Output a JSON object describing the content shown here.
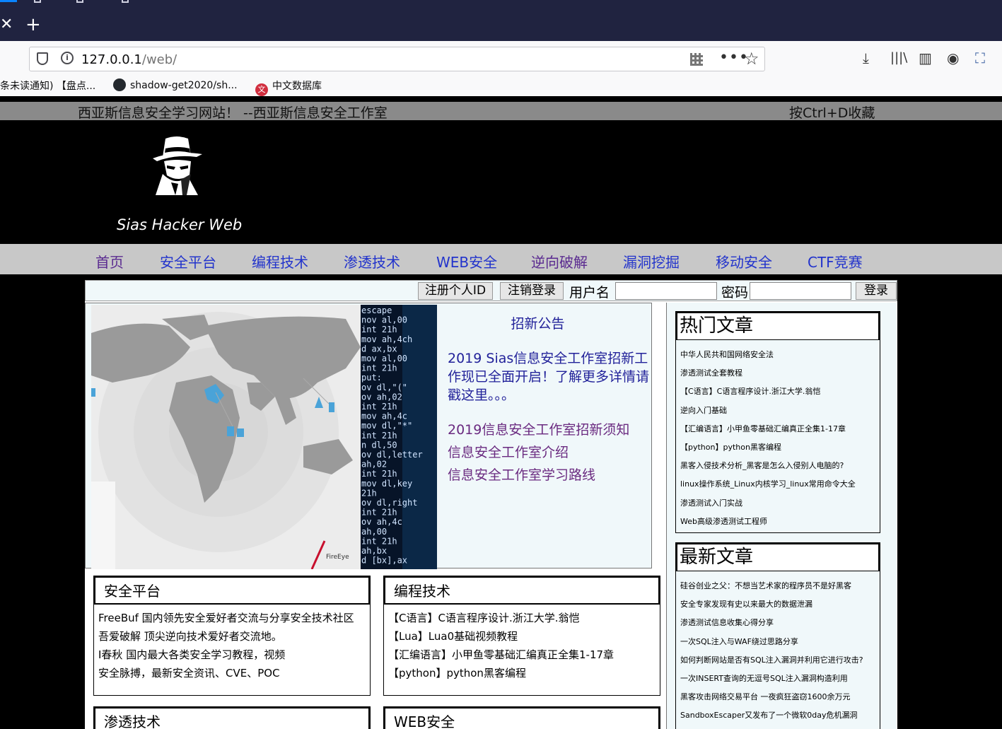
{
  "browser": {
    "url_host": "127.0.0.1",
    "url_path": "/web/",
    "tab_close_glyph": "✕",
    "tab_new_glyph": "+",
    "bookmarks": [
      {
        "label": "条未读通知) 【盘点...",
        "icon": "none"
      },
      {
        "label": "shadow-get2020/sh...",
        "icon": "github-icon"
      },
      {
        "label": "中文数据库",
        "icon": "cnki-icon"
      }
    ]
  },
  "site": {
    "topbar_left": "西亚斯信息安全学习网站！ --西亚斯信息安全工作室",
    "topbar_right": "按Ctrl+D收藏",
    "name": "Sias Hacker Web",
    "nav": [
      "首页",
      "安全平台",
      "编程技术",
      "渗透技术",
      "WEB安全",
      "逆向破解",
      "漏洞挖掘",
      "移动安全",
      "CTF竞赛"
    ]
  },
  "login": {
    "register_label": "注册个人ID",
    "logout_label": "注销登录",
    "username_label": "用户名",
    "password_label": "密码",
    "login_label": "登录"
  },
  "banner": {
    "brand": "FireEye",
    "code_lines": [
      "escape",
      "nov al,00",
      "int 21h",
      "mov ah,4ch",
      "d ax,bx",
      "mov al,00",
      "int 21h",
      "put:",
      "ov dl,\"(\"",
      "ov ah,02",
      "int 21h",
      "mov ah,4c",
      "mov dl,\"*\"",
      "int 21h",
      "n dl,50",
      "ov dl,letter",
      "ah,02",
      "int 21h",
      "mov dl,key",
      "21h",
      "ov dl,right",
      "int 21h",
      "ov ah,4c",
      "ah,00",
      "int 21h",
      "ah,bx",
      "d [bx],ax"
    ]
  },
  "notice": {
    "title": "招新公告",
    "main": "2019 Sias信息安全工作室招新工作现已全面开启！了解更多详情请戳这里。。。",
    "links": [
      "2019信息安全工作室招新须知",
      "信息安全工作室介绍",
      "信息安全工作室学习路线"
    ]
  },
  "hot": {
    "title": "热门文章",
    "items": [
      "中华人民共和国网络安全法",
      "渗透测试全套教程",
      "【C语言】C语言程序设计.浙江大学.翁恺",
      "逆向入门基础",
      "【汇编语言】小甲鱼零基础汇编真正全集1-17章",
      "【python】python黑客编程",
      "黑客入侵技术分析_黑客是怎么入侵别人电脑的?",
      "linux操作系统_Linux内核学习_linux常用命令大全",
      "渗透测试入门实战",
      "Web高级渗透测试工程师"
    ]
  },
  "latest": {
    "title": "最新文章",
    "items": [
      "硅谷创业之父：不想当艺术家的程序员不是好黑客",
      "安全专家发现有史以来最大的数据泄漏",
      "渗透测试信息收集心得分享",
      "一次SQL注入与WAF绕过思路分享",
      "如何判断网站是否有SQL注入漏洞并利用它进行攻击?",
      "一次INSERT查询的无逗号SQL注入漏洞构造利用",
      "黑客攻击网络交易平台 一夜疯狂盗窃1600余万元",
      "SandboxEscaper又发布了一个微软0day危机漏洞"
    ]
  },
  "categories": [
    {
      "title": "安全平台",
      "items": [
        "FreeBuf 国内领先安全爱好者交流与分享安全技术社区",
        "吾爱破解 顶尖逆向技术爱好者交流地。",
        "I春秋 国内最大各类安全学习教程，视频",
        "安全脉搏，最新安全资讯、CVE、POC"
      ]
    },
    {
      "title": "编程技术",
      "items": [
        "【C语言】C语言程序设计.浙江大学.翁恺",
        "【Lua】Lua0基础视频教程",
        "【汇编语言】小甲鱼零基础汇编真正全集1-17章",
        "【python】python黑客编程"
      ]
    },
    {
      "title": "渗透技术",
      "items": []
    },
    {
      "title": "WEB安全",
      "items": []
    }
  ]
}
